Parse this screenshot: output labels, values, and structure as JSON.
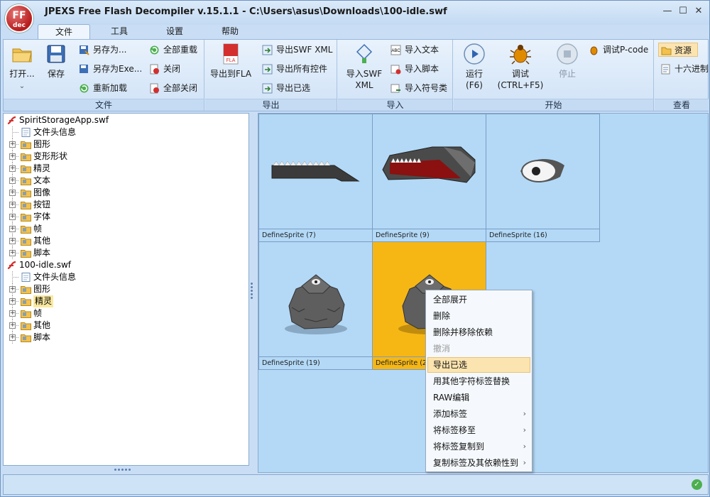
{
  "app": {
    "logo_text": "FF",
    "logo_sub": "dec",
    "title": "JPEXS Free Flash Decompiler v.15.1.1 - C:\\Users\\asus\\Downloads\\100-idle.swf",
    "window_controls": {
      "minimize": "—",
      "maximize": "☐",
      "close": "✕"
    }
  },
  "menu": {
    "tabs": [
      {
        "label": "文件",
        "active": true
      },
      {
        "label": "工具",
        "active": false
      },
      {
        "label": "设置",
        "active": false
      },
      {
        "label": "帮助",
        "active": false
      }
    ]
  },
  "ribbon": {
    "file_group": {
      "label": "文件",
      "open": "打开...",
      "save": "保存",
      "save_as": "另存为...",
      "save_as_exe": "另存为Exe...",
      "reload": "重新加载",
      "reload_all": "全部重载",
      "close": "关闭",
      "close_all": "全部关闭"
    },
    "export_group": {
      "label": "导出",
      "export_fla": "导出到FLA",
      "export_swf_xml": "导出SWF XML",
      "export_all": "导出所有控件",
      "export_selected": "导出已选"
    },
    "import_group": {
      "label": "导入",
      "import_swf_xml_1": "导入SWF",
      "import_swf_xml_2": "XML",
      "import_text": "导入文本",
      "import_script": "导入脚本",
      "import_symbol": "导入符号类"
    },
    "start_group": {
      "label": "开始",
      "run_1": "运行",
      "run_2": "(F6)",
      "debug_1": "调试",
      "debug_2": "(CTRL+F5)",
      "stop": "停止",
      "debug_pcode": "调试P-code"
    },
    "view_group": {
      "label": "查看",
      "resources": "资源",
      "hex": "十六进制"
    }
  },
  "tree": {
    "rows": [
      {
        "label": "SpiritStorageApp.swf",
        "level": 0,
        "expander": "",
        "icon": "swf-file-icon"
      },
      {
        "label": "文件头信息",
        "level": 1,
        "expander": "",
        "icon": "header-icon"
      },
      {
        "label": "图形",
        "level": 1,
        "expander": "+",
        "icon": "shapes-folder-icon"
      },
      {
        "label": "变形形状",
        "level": 1,
        "expander": "+",
        "icon": "morphshapes-folder-icon"
      },
      {
        "label": "精灵",
        "level": 1,
        "expander": "+",
        "icon": "sprites-folder-icon"
      },
      {
        "label": "文本",
        "level": 1,
        "expander": "+",
        "icon": "texts-folder-icon"
      },
      {
        "label": "图像",
        "level": 1,
        "expander": "+",
        "icon": "images-folder-icon"
      },
      {
        "label": "按钮",
        "level": 1,
        "expander": "+",
        "icon": "buttons-folder-icon"
      },
      {
        "label": "字体",
        "level": 1,
        "expander": "+",
        "icon": "fonts-folder-icon"
      },
      {
        "label": "帧",
        "level": 1,
        "expander": "+",
        "icon": "frames-folder-icon"
      },
      {
        "label": "其他",
        "level": 1,
        "expander": "+",
        "icon": "others-folder-icon"
      },
      {
        "label": "脚本",
        "level": 1,
        "expander": "+",
        "icon": "scripts-folder-icon"
      },
      {
        "label": "100-idle.swf",
        "level": 0,
        "expander": "",
        "icon": "swf-file-icon"
      },
      {
        "label": "文件头信息",
        "level": 1,
        "expander": "",
        "icon": "header-icon"
      },
      {
        "label": "图形",
        "level": 1,
        "expander": "+",
        "icon": "shapes-folder-icon"
      },
      {
        "label": "精灵",
        "level": 1,
        "expander": "+",
        "icon": "sprites-folder-icon",
        "highlight": true
      },
      {
        "label": "帧",
        "level": 1,
        "expander": "+",
        "icon": "frames-folder-icon"
      },
      {
        "label": "其他",
        "level": 1,
        "expander": "+",
        "icon": "others-folder-icon"
      },
      {
        "label": "脚本",
        "level": 1,
        "expander": "+",
        "icon": "scripts-folder-icon"
      }
    ]
  },
  "grid": {
    "cells": [
      {
        "label": "DefineSprite (7)",
        "art": "blade",
        "selected": false
      },
      {
        "label": "DefineSprite (9)",
        "art": "jaw",
        "selected": false
      },
      {
        "label": "DefineSprite (16)",
        "art": "eye",
        "selected": false
      },
      {
        "label": "DefineSprite (19)",
        "art": "golem",
        "selected": false
      },
      {
        "label": "DefineSprite (2",
        "art": "golem",
        "selected": true
      }
    ]
  },
  "context_menu": {
    "items": [
      {
        "label": "全部展开",
        "disabled": false,
        "submenu": false
      },
      {
        "label": "删除",
        "disabled": false,
        "submenu": false
      },
      {
        "label": "删除并移除依赖",
        "disabled": false,
        "submenu": false
      },
      {
        "label": "撤消",
        "disabled": true,
        "submenu": false
      },
      {
        "label": "导出已选",
        "disabled": false,
        "submenu": false,
        "hover": true
      },
      {
        "label": "用其他字符标签替换",
        "disabled": false,
        "submenu": false
      },
      {
        "label": "RAW编辑",
        "disabled": false,
        "submenu": false
      },
      {
        "label": "添加标签",
        "disabled": false,
        "submenu": true
      },
      {
        "label": "将标签移至",
        "disabled": false,
        "submenu": true
      },
      {
        "label": "将标签复制到",
        "disabled": false,
        "submenu": true
      },
      {
        "label": "复制标签及其依赖性到",
        "disabled": false,
        "submenu": true
      }
    ]
  },
  "status": {
    "ok_icon": "✓"
  }
}
